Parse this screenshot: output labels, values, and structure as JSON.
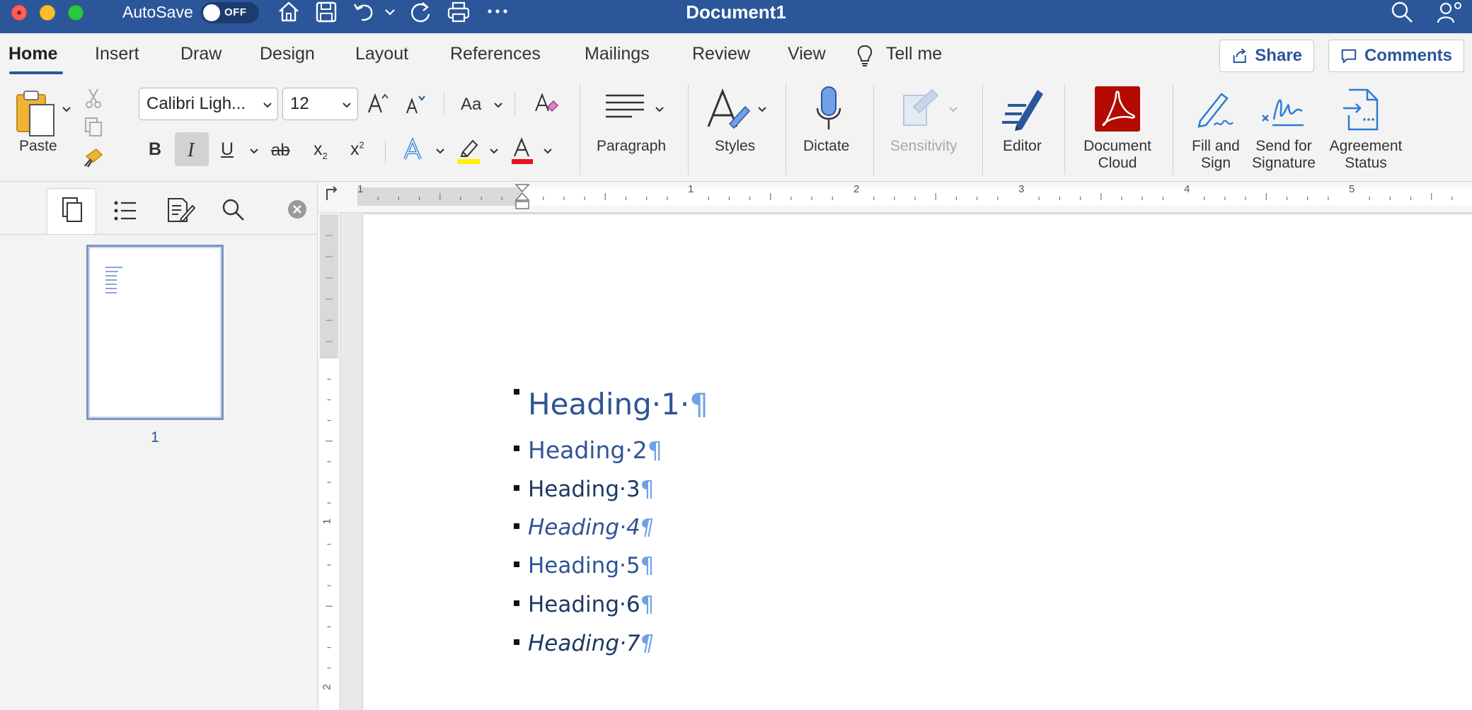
{
  "titlebar": {
    "autosave_label": "AutoSave",
    "autosave_state": "OFF",
    "document_title": "Document1"
  },
  "tabs": {
    "items": [
      {
        "label": "Home"
      },
      {
        "label": "Insert"
      },
      {
        "label": "Draw"
      },
      {
        "label": "Design"
      },
      {
        "label": "Layout"
      },
      {
        "label": "References"
      },
      {
        "label": "Mailings"
      },
      {
        "label": "Review"
      },
      {
        "label": "View"
      }
    ],
    "tell_me": "Tell me",
    "share": "Share",
    "comments": "Comments"
  },
  "ribbon": {
    "paste": "Paste",
    "font_name": "Calibri Ligh...",
    "font_size": "12",
    "case_label": "Aa",
    "bold": "B",
    "italic": "I",
    "underline": "U",
    "strike": "ab",
    "subscript": "x",
    "sub_digit": "2",
    "superscript": "x",
    "sup_digit": "2",
    "paragraph": "Paragraph",
    "styles": "Styles",
    "dictate": "Dictate",
    "sensitivity": "Sensitivity",
    "editor": "Editor",
    "document_cloud_1": "Document",
    "document_cloud_2": "Cloud",
    "fill_sign_1": "Fill and",
    "fill_sign_2": "Sign",
    "send_sig_1": "Send for",
    "send_sig_2": "Signature",
    "agreement_1": "Agreement",
    "agreement_2": "Status",
    "accent_color": "#2b579a",
    "highlight_color": "#fff200",
    "font_color": "#e81123"
  },
  "nav": {
    "page_number": "1"
  },
  "ruler": {
    "h_numbers": [
      "1",
      "1",
      "2",
      "3",
      "4",
      "5"
    ],
    "v_numbers": [
      "1",
      "2"
    ]
  },
  "document": {
    "paragraphs": [
      {
        "text": "Heading·1·",
        "mark": "¶"
      },
      {
        "text": "Heading·2",
        "mark": "¶"
      },
      {
        "text": "Heading·3",
        "mark": "¶"
      },
      {
        "text": "Heading·4",
        "mark": "¶"
      },
      {
        "text": "Heading·5",
        "mark": "¶"
      },
      {
        "text": "Heading·6",
        "mark": "¶"
      },
      {
        "text": "Heading·7",
        "mark": "¶"
      }
    ]
  }
}
